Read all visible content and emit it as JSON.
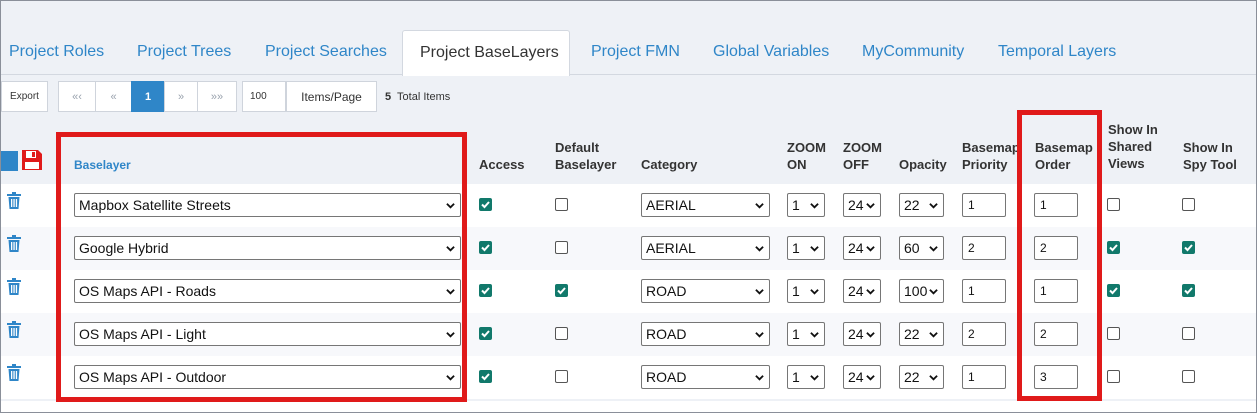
{
  "tabs": [
    {
      "label": "Project Roles",
      "active": false
    },
    {
      "label": "Project Trees",
      "active": false
    },
    {
      "label": "Project Searches",
      "active": false
    },
    {
      "label": "Project BaseLayers",
      "active": true
    },
    {
      "label": "Project FMN",
      "active": false
    },
    {
      "label": "Global Variables",
      "active": false
    },
    {
      "label": "MyCommunity",
      "active": false
    },
    {
      "label": "Temporal Layers",
      "active": false
    }
  ],
  "toolbar": {
    "export_label": "Export",
    "first_label": "«‹",
    "prev_label": "«",
    "current_page": "1",
    "next_label": "»",
    "last_label": "»»",
    "items_per_page_value": "100",
    "items_per_page_label": "Items/Page",
    "total_count": "5",
    "total_label": "Total Items"
  },
  "headers": {
    "baselayer": "Baselayer",
    "access": "Access",
    "default_baselayer": "Default Baselayer",
    "category": "Category",
    "zoom_on": "ZOOM ON",
    "zoom_off": "ZOOM OFF",
    "opacity": "Opacity",
    "basemap_priority": "Basemap Priority",
    "basemap_order": "Basemap Order",
    "show_in_shared_views": "Show In Shared Views",
    "show_in_spy_tool": "Show In Spy Tool"
  },
  "rows": [
    {
      "baselayer": "Mapbox Satellite Streets",
      "access": true,
      "default": false,
      "category": "AERIAL",
      "zoom_on": "1",
      "zoom_off": "24",
      "opacity": "22",
      "priority": "1",
      "order": "1",
      "shared": false,
      "spy": false
    },
    {
      "baselayer": "Google Hybrid",
      "access": true,
      "default": false,
      "category": "AERIAL",
      "zoom_on": "1",
      "zoom_off": "24",
      "opacity": "60",
      "priority": "2",
      "order": "2",
      "shared": true,
      "spy": true
    },
    {
      "baselayer": "OS Maps API - Roads",
      "access": true,
      "default": true,
      "category": "ROAD",
      "zoom_on": "1",
      "zoom_off": "24",
      "opacity": "100",
      "priority": "1",
      "order": "1",
      "shared": true,
      "spy": true
    },
    {
      "baselayer": "OS Maps API - Light",
      "access": true,
      "default": false,
      "category": "ROAD",
      "zoom_on": "1",
      "zoom_off": "24",
      "opacity": "22",
      "priority": "2",
      "order": "2",
      "shared": false,
      "spy": false
    },
    {
      "baselayer": "OS Maps API - Outdoor",
      "access": true,
      "default": false,
      "category": "ROAD",
      "zoom_on": "1",
      "zoom_off": "24",
      "opacity": "22",
      "priority": "1",
      "order": "3",
      "shared": false,
      "spy": false
    }
  ],
  "colors": {
    "accent": "#2f86c8",
    "highlight_box": "#e01a1a",
    "checkbox_on": "#11796b",
    "save_icon": "#e01a1a"
  },
  "icons": {
    "delete": "trash-icon",
    "save": "floppy-disk-icon",
    "dropdown": "chevron-down-icon"
  }
}
